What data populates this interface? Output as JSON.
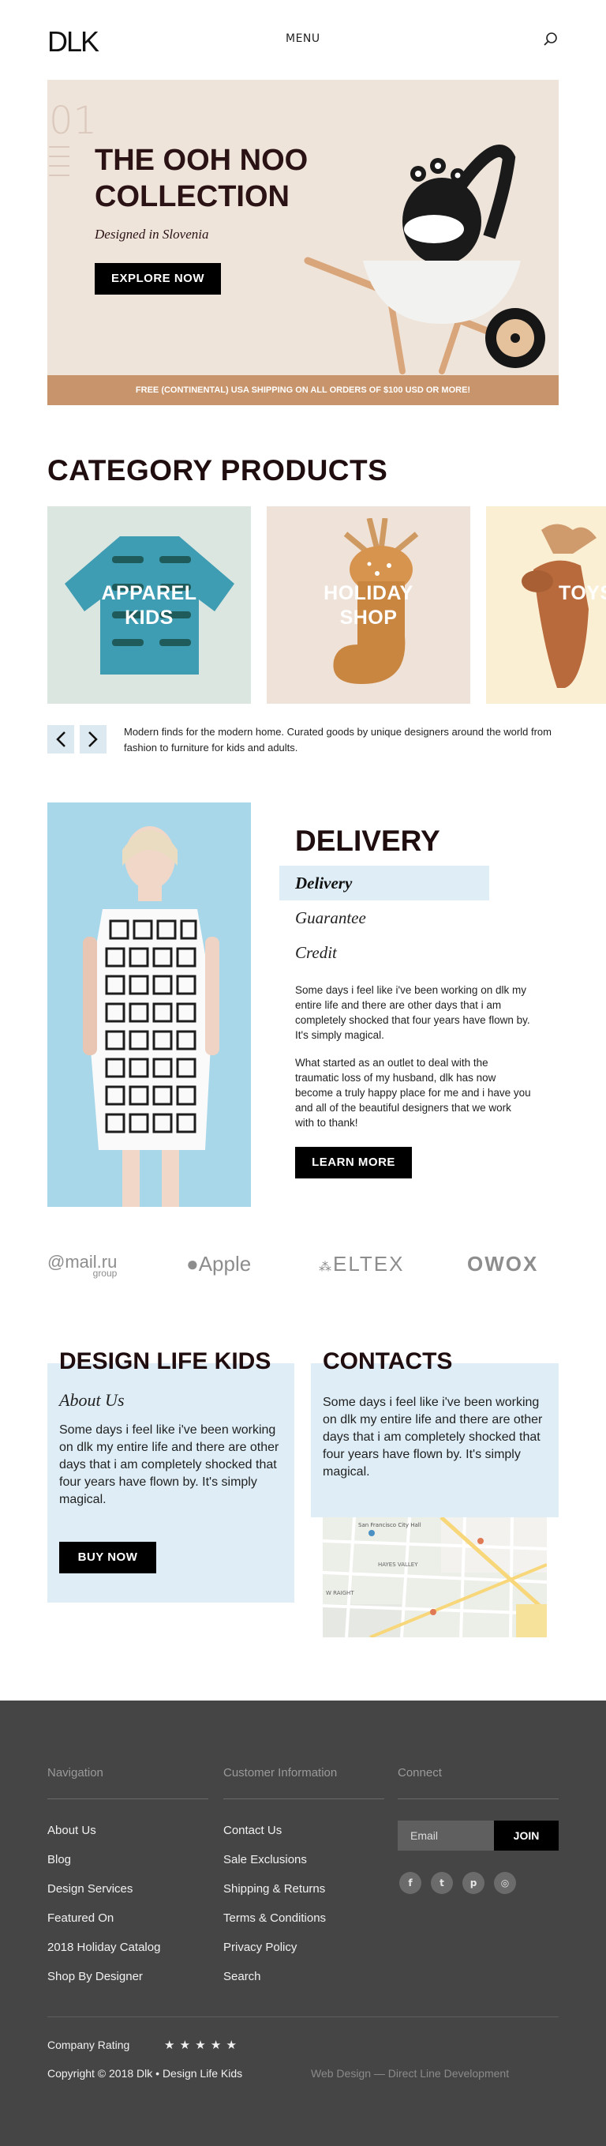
{
  "header": {
    "logo": "DLK",
    "menu": "MENU",
    "search_icon": "search-icon"
  },
  "hero": {
    "number": "01",
    "title": "THE OOH NOO COLLECTION",
    "subtitle": "Designed in Slovenia",
    "button": "EXPLORE NOW",
    "shipping": "FREE (CONTINENTAL) USA SHIPPING ON ALL ORDERS OF $100 USD OR MORE!"
  },
  "categories": {
    "title": "CATEGORY PRODUCTS",
    "items": [
      {
        "label_line1": "APPAREL",
        "label_line2": "KIDS"
      },
      {
        "label_line1": "HOLIDAY",
        "label_line2": "SHOP"
      },
      {
        "label_line1": "TOYS",
        "label_line2": ""
      }
    ],
    "prev_icon": "chevron-left-icon",
    "next_icon": "chevron-right-icon",
    "description": "Modern finds for the modern home. Curated goods by unique designers around the world from fashion to furniture for kids and adults."
  },
  "delivery": {
    "title": "DELIVERY",
    "tabs": [
      "Delivery",
      "Guarantee",
      "Credit"
    ],
    "p1": "Some days i feel like i've been working on dlk my entire life and there are other days that i am completely shocked that four years have flown by. It's simply magical.",
    "p2": "What started as an outlet to deal  with the traumatic loss of my husband, dlk has now become a truly happy place for me and i have you and all of the beautiful designers that we work with to thank!",
    "button": "LEARN MORE"
  },
  "brands": {
    "mailru": "@mail.ru",
    "mailru_sub": "group",
    "apple": "Apple",
    "eltex": "ELTEX",
    "owox": "OWOX"
  },
  "design_life": {
    "title": "DESIGN LIFE KIDS",
    "subtitle": "About Us",
    "text": "Some days i feel like i've been working on dlk my entire life and there are other days that i am completely shocked that four years have flown by. It's simply magical.",
    "button": "BUY NOW"
  },
  "contacts": {
    "title": "CONTACTS",
    "text": "Some days i feel like i've been working on dlk my entire life and there are other days that i am completely shocked that four years have flown by. It's simply magical.",
    "map_labels": [
      "San Francisco City Hall",
      "HAYES VALLEY",
      "W RAIGHT"
    ]
  },
  "footer": {
    "nav_head": "Navigation",
    "nav": [
      "About Us",
      "Blog",
      "Design Services",
      "Featured On",
      "2018 Holiday Catalog",
      "Shop By Designer"
    ],
    "info_head": "Customer Information",
    "info": [
      "Contact Us",
      "Sale Exclusions",
      "Shipping & Returns",
      "Terms & Conditions",
      "Privacy Policy",
      "Search"
    ],
    "connect_head": "Connect",
    "email_placeholder": "Email",
    "join": "JOIN",
    "rating_label": "Company Rating",
    "stars": "★ ★ ★ ★ ★",
    "copyright": "Copyright © 2018 Dlk • Design Life Kids",
    "credit": "Web Design — Direct Line Development"
  },
  "colors": {
    "accent_tan": "#c8946b",
    "light_blue": "#dfeef6",
    "footer": "#454545"
  }
}
